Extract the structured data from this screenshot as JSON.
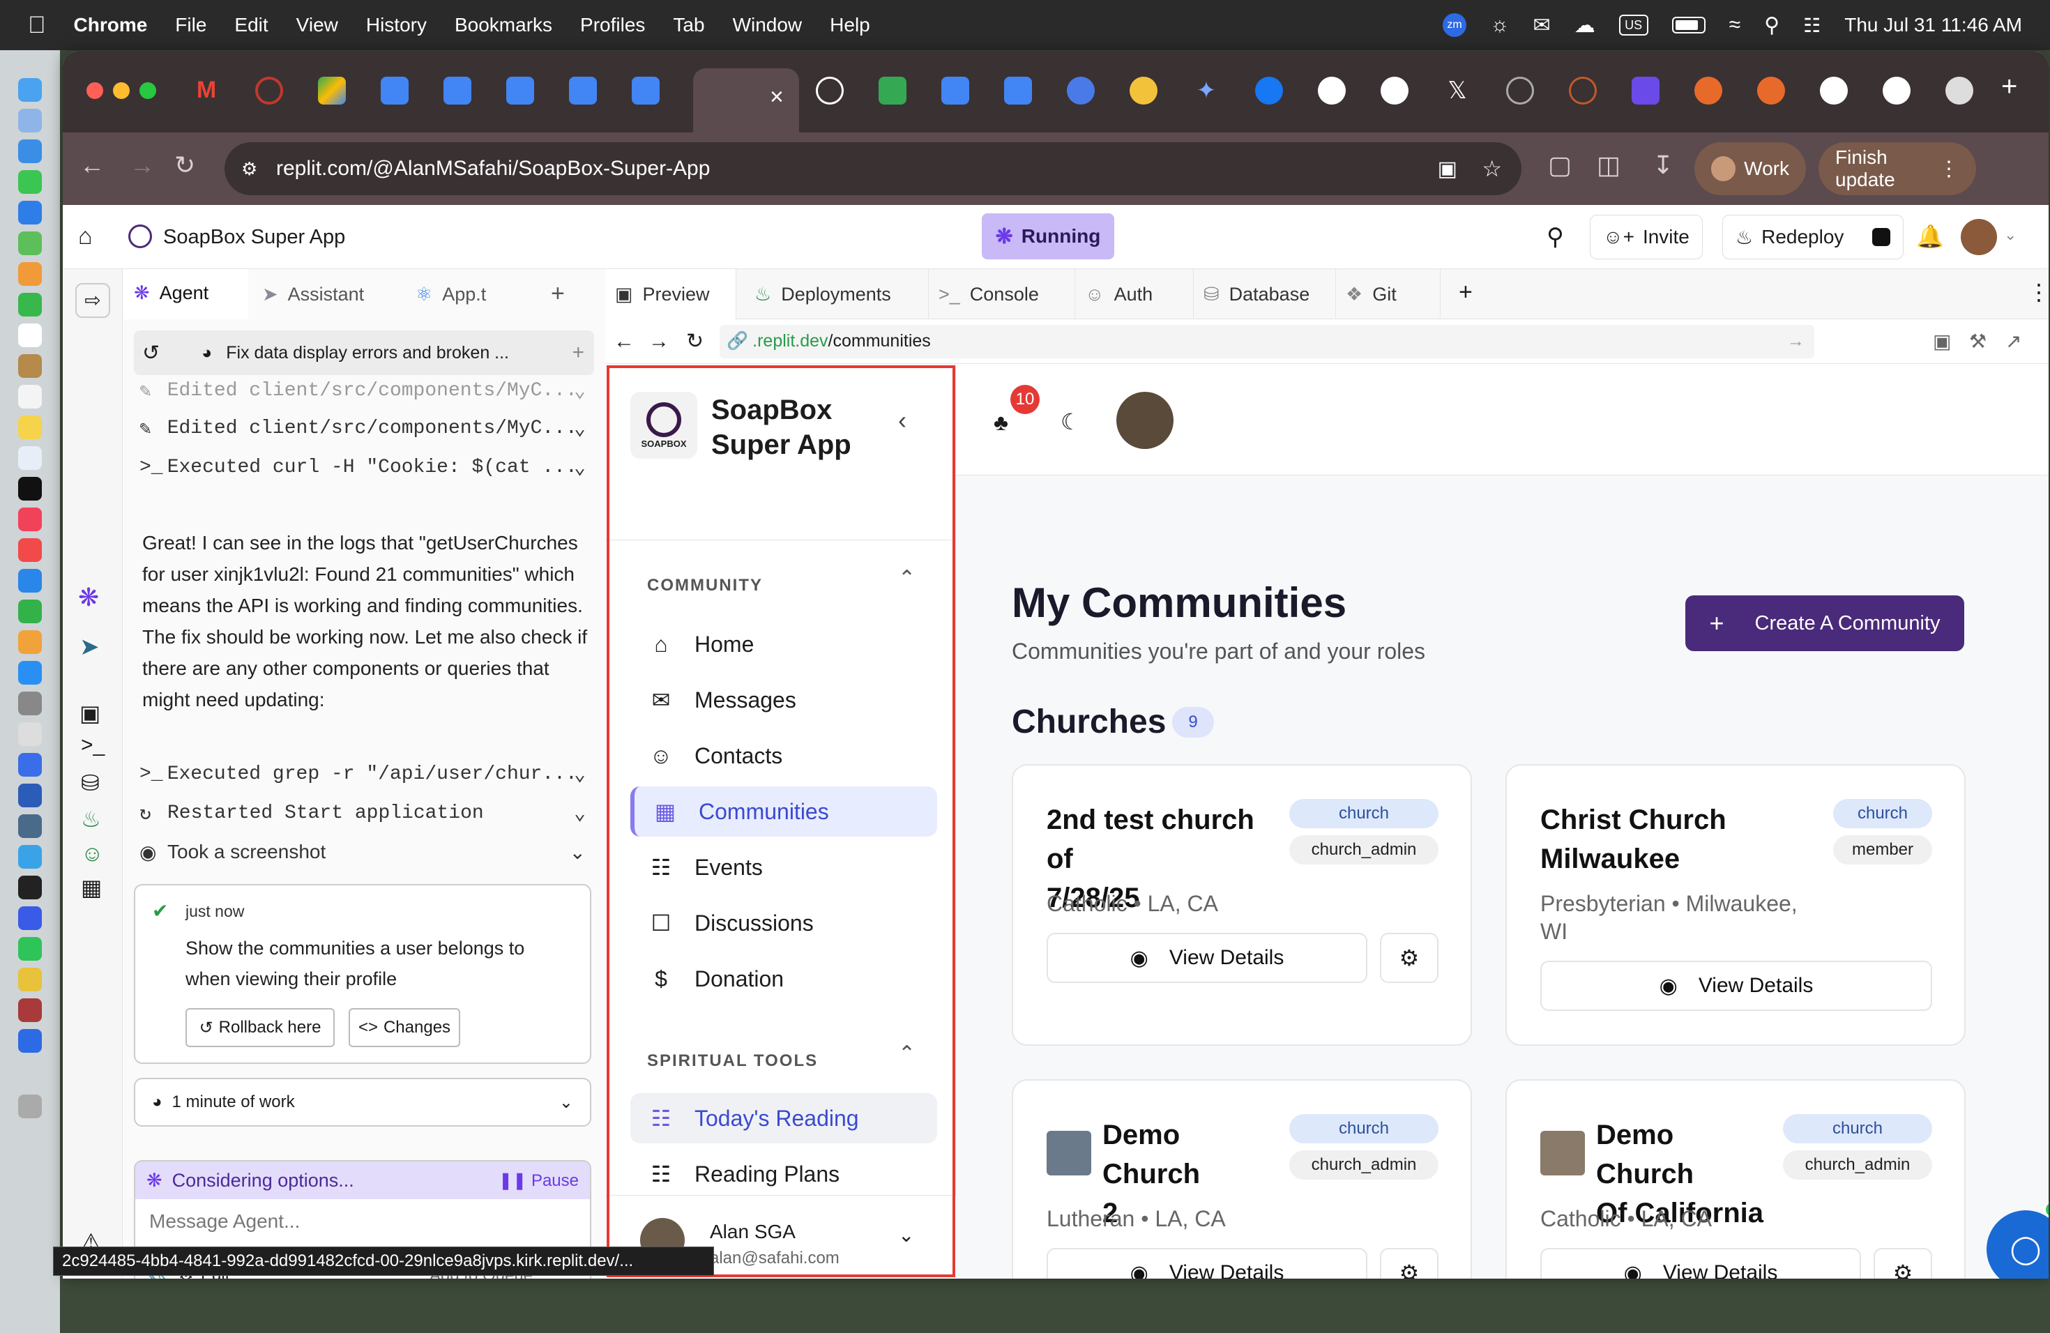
{
  "menubar": {
    "app": "Chrome",
    "items": [
      "File",
      "Edit",
      "View",
      "History",
      "Bookmarks",
      "Profiles",
      "Tab",
      "Window",
      "Help"
    ],
    "input_source": "US",
    "datetime": "Thu Jul 31  11:46 AM"
  },
  "browser": {
    "url": "replit.com/@AlanMSafahi/SoapBox-Super-App",
    "profile": "Work",
    "update_label": "Finish update"
  },
  "replit": {
    "project_name": "SoapBox Super App",
    "status": "Running",
    "invite_label": "Invite",
    "redeploy_label": "Redeploy"
  },
  "agent_panel": {
    "tabs": [
      "Agent",
      "Assistant",
      "App.t"
    ],
    "thread_title": "Fix data display errors and broken ...",
    "log_top": [
      "Edited client/src/components/MyC...",
      "Edited client/src/components/MyC...",
      "Executed curl -H \"Cookie: $(cat ..."
    ],
    "message": "Great! I can see in the logs that \"getUserChurches for user xinjk1vlu2l: Found 21 communities\" which means the API is working and finding communities. The fix should be working now. Let me also check if there are any other components or queries that might need updating:",
    "log_bottom": [
      "Executed grep -r \"/api/user/chur...",
      "Restarted Start application",
      "Took a screenshot"
    ],
    "checkpoint": {
      "time": "just now",
      "text": "Show the communities a user belongs to when viewing their profile",
      "rollback": "Rollback here",
      "changes": "Changes"
    },
    "work_time": "1 minute of work",
    "considering": "Considering options...",
    "pause": "Pause",
    "input_placeholder": "Message Agent...",
    "edit_label": "Edit",
    "queue_label": "Add to Queue"
  },
  "workspace": {
    "tabs": [
      "Preview",
      "Deployments",
      "Console",
      "Auth",
      "Database",
      "Git"
    ],
    "preview_url_prefix": ".replit.dev",
    "preview_url_path": "/communities"
  },
  "app": {
    "brand_line1": "SoapBox",
    "brand_line2": "Super App",
    "logo_text": "SOAPBOX",
    "sections": [
      {
        "title": "COMMUNITY",
        "items": [
          "Home",
          "Messages",
          "Contacts",
          "Communities",
          "Events",
          "Discussions",
          "Donation"
        ]
      },
      {
        "title": "SPIRITUAL TOOLS",
        "items": [
          "Today's Reading",
          "Reading Plans"
        ]
      }
    ],
    "user": {
      "name": "Alan SGA",
      "email": "alan@safahi.com"
    },
    "notification_count": "10",
    "page_title": "My Communities",
    "page_subtitle": "Communities you're part of and your roles",
    "create_button": "Create A Community",
    "section_title": "Churches",
    "section_count": "9",
    "view_details": "View Details",
    "cards": [
      {
        "name_l1": "2nd test church of",
        "name_l2": "7/28/25",
        "type": "church",
        "role": "church_admin",
        "sub_l1": "Catholic • LA, CA",
        "sub_l2": ""
      },
      {
        "name_l1": "Christ Church",
        "name_l2": "Milwaukee",
        "type": "church",
        "role": "member",
        "sub_l1": "Presbyterian • Milwaukee,",
        "sub_l2": "WI"
      },
      {
        "name_l1": "Demo Church",
        "name_l2": "2",
        "type": "church",
        "role": "church_admin",
        "sub_l1": "Lutheran • LA, CA",
        "sub_l2": ""
      },
      {
        "name_l1": "Demo Church",
        "name_l2": "Of California",
        "type": "church",
        "role": "church_admin",
        "sub_l1": "Catholic • LA, CA",
        "sub_l2": ""
      }
    ]
  },
  "status_bar_url": "2c924485-4bb4-4841-992a-dd991482cfcd-00-29nlce9a8jvps.kirk.replit.dev/...",
  "colors": {
    "accent": "#4a2a7a",
    "active_nav": "#e8ecff",
    "highlight": "#e53935",
    "running": "#c9b9f7"
  }
}
